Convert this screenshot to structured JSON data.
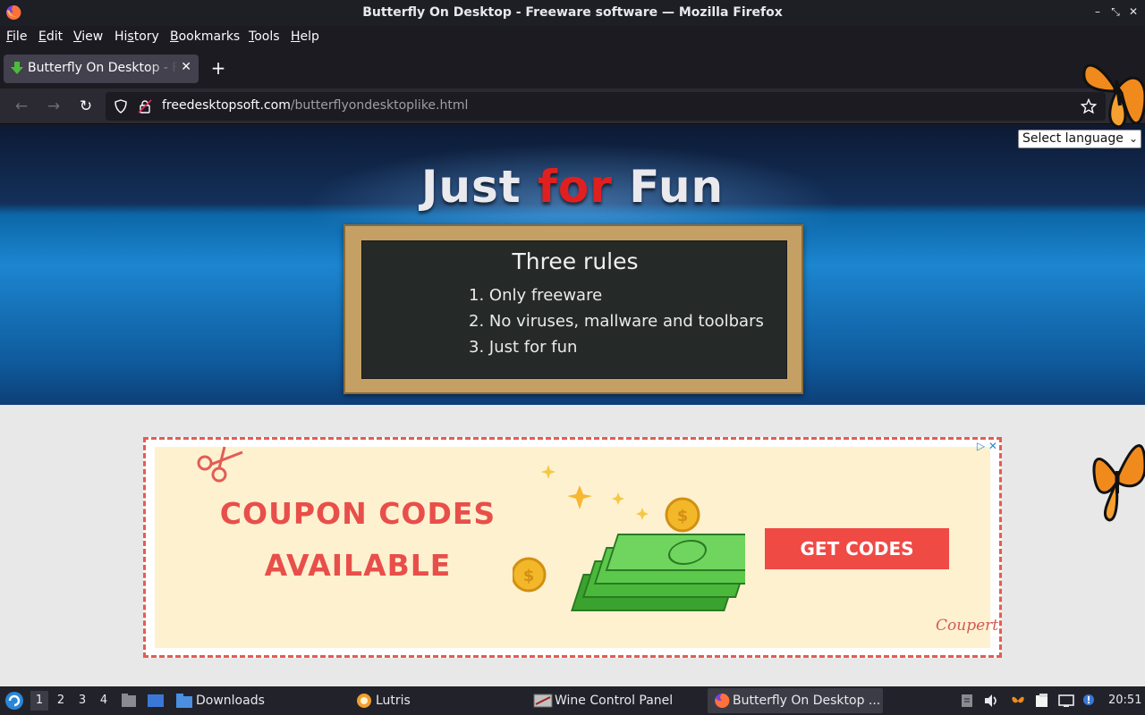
{
  "window": {
    "title": "Butterfly On Desktop - Freeware software — Mozilla Firefox"
  },
  "menu": {
    "items": [
      {
        "label": "File",
        "mnemonic": "F",
        "rest": "ile"
      },
      {
        "label": "Edit",
        "mnemonic": "E",
        "rest": "dit"
      },
      {
        "label": "View",
        "mnemonic": "V",
        "rest": "iew"
      },
      {
        "label": "History",
        "mnemonic": "s",
        "pre": "Hi",
        "rest": "tory"
      },
      {
        "label": "Bookmarks",
        "mnemonic": "B",
        "rest": "ookmarks"
      },
      {
        "label": "Tools",
        "mnemonic": "T",
        "rest": "ools"
      },
      {
        "label": "Help",
        "mnemonic": "H",
        "rest": "elp"
      }
    ]
  },
  "tabs": [
    {
      "title": "Butterfly On Desktop - Freeware software",
      "active": true
    }
  ],
  "urlbar": {
    "domain": "freedesktopsoft.com",
    "path": "/butterflyondesktoplike.html"
  },
  "page": {
    "language_select": "Select language",
    "heading_part1": "Just ",
    "heading_part2": "for",
    "heading_part3": " Fun",
    "board": {
      "title": "Three rules",
      "rules": [
        "1. Only freeware",
        "2. No viruses, mallware and toolbars",
        "3. Just for fun"
      ]
    },
    "ad": {
      "headline_line1": "COUPON CODES",
      "headline_line2": "AVAILABLE",
      "cta": "GET CODES",
      "brand": "Coupert"
    }
  },
  "taskbar": {
    "workspaces": [
      "1",
      "2",
      "3",
      "4"
    ],
    "active_workspace": "1",
    "windows": [
      {
        "label": "Downloads"
      },
      {
        "label": "Lutris"
      },
      {
        "label": "Wine Control Panel"
      },
      {
        "label": "Butterfly On Desktop ..."
      }
    ],
    "clock": "20:51"
  },
  "colors": {
    "accent_red": "#e02020",
    "ad_red": "#f04a45",
    "ad_bg": "#fdf1d0"
  }
}
